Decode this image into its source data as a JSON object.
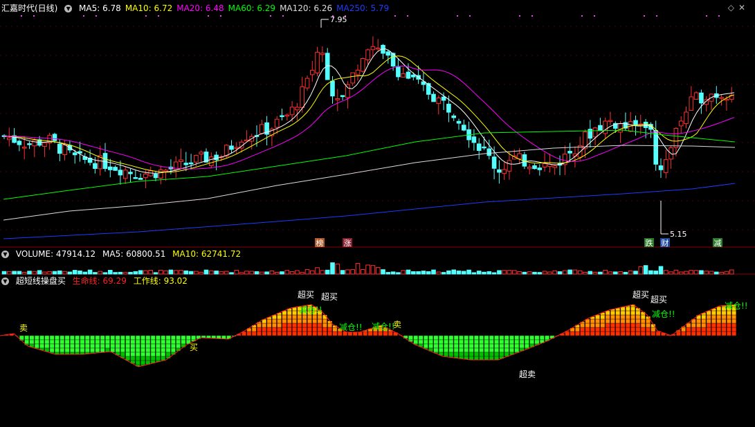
{
  "main_pane": {
    "title": "汇嘉时代(日线)",
    "ma": [
      {
        "label": "MA5: 6.78",
        "color": "#ffffff"
      },
      {
        "label": "MA10: 6.72",
        "color": "#ffff00"
      },
      {
        "label": "MA20: 6.48",
        "color": "#ff00ff"
      },
      {
        "label": "MA60: 6.29",
        "color": "#00ff00"
      },
      {
        "label": "MA120: 6.26",
        "color": "#dddddd"
      },
      {
        "label": "MA250: 5.79",
        "color": "#1e3cff"
      }
    ],
    "high_label": "7.95",
    "low_label": "5.15",
    "event_tags": [
      {
        "text": "榜",
        "bg": "#b05a2a"
      },
      {
        "text": "涨",
        "bg": "#8a2030"
      },
      {
        "text": "跌",
        "bg": "#2a7a2a"
      },
      {
        "text": "财",
        "bg": "#1e4aa0"
      },
      {
        "text": "减",
        "bg": "#2a7a2a"
      }
    ]
  },
  "volume_pane": {
    "volume": "VOLUME: 47914.12",
    "ma5": "MA5: 60800.51",
    "ma10": "MA10: 62741.72"
  },
  "indicator_pane": {
    "title": "超短线操盘买",
    "life_line": "生命线: 69.29",
    "work_line": "工作线: 93.02",
    "signals": [
      {
        "text": "卖",
        "color": "#ffff00"
      },
      {
        "text": "买",
        "color": "#ffff00"
      },
      {
        "text": "超买",
        "color": "#ffffff"
      },
      {
        "text": "减仓!!",
        "color": "#00ff00"
      },
      {
        "text": "超买",
        "color": "#ffffff"
      },
      {
        "text": "减仓!!",
        "color": "#00ff00"
      },
      {
        "text": "减仓!!",
        "color": "#00ff00"
      },
      {
        "text": "卖",
        "color": "#ffff00"
      },
      {
        "text": "超卖",
        "color": "#ffffff"
      },
      {
        "text": "超买",
        "color": "#ffffff"
      },
      {
        "text": "超买",
        "color": "#ffffff"
      },
      {
        "text": "减仓!!",
        "color": "#00ff00"
      },
      {
        "text": "减仓!!",
        "color": "#00ff00"
      }
    ]
  },
  "colors": {
    "up_candle": "#ff3030",
    "down_candle": "#54ffff",
    "divider": "#8b0000"
  },
  "icons": [
    "chevron-down-icon",
    "diamond-icon",
    "close-icon"
  ]
}
